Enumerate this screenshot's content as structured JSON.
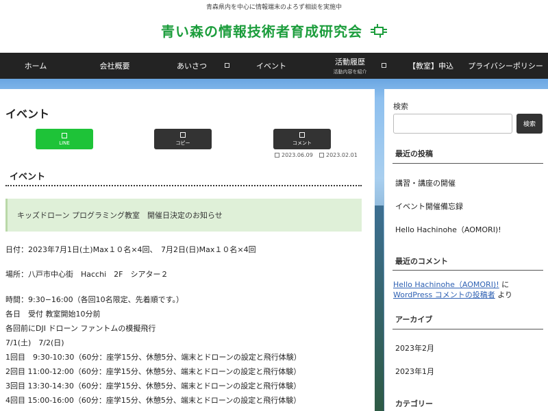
{
  "header": {
    "tagline": "青森県内を中心に情報端末のよろず相談を実施中",
    "site_title": "青い森の情報技術者育成研究会"
  },
  "nav": {
    "items": [
      {
        "label": "ホーム"
      },
      {
        "label": "会社概要"
      },
      {
        "label": "あいさつ"
      },
      {
        "label": "イベント"
      },
      {
        "label": "活動履歴",
        "sub": "活動内容を紹介"
      },
      {
        "label": "【教室】申込"
      },
      {
        "label": "プライバシーポリシー"
      }
    ]
  },
  "main": {
    "page_title": "イベント",
    "share": {
      "line": "LINE",
      "copy": "コピー",
      "comment": "コメント"
    },
    "date_updated": "2023.06.09",
    "date_published": "2023.02.01",
    "section_title": "イベント",
    "notice": "キッズドローン プログラミング教室　開催日決定のお知らせ",
    "lines": [
      "日付：2023年7月1日(土)Max１０名×4回、　7月2日(日)Max１０名×4回",
      "場所：八戸市中心街　Hacchi　2F　シアター２",
      "時間：9:30−16:00（各回10名限定、先着順です。）",
      "各日　受付 教室開始10分前",
      "各回前にDJI ドローン ファントムの模擬飛行",
      "7/1(土)　7/2(日)",
      "1回目　9:30-10:30（60分：座学15分、休憩5分、端末とドローンの設定と飛行体験）",
      "2回目 11:00-12:00（60分：座学15分、休憩5分、端末とドローンの設定と飛行体験）",
      "3回目 13:30-14:30（60分：座学15分、休憩5分、端末とドローンの設定と飛行体験）",
      "4回目 15:00-16:00（60分：座学15分、休憩5分、端末とドローンの設定と飛行体験）"
    ]
  },
  "sidebar": {
    "search_label": "検索",
    "search_button": "検索",
    "recent_posts_title": "最近の投稿",
    "recent_posts": [
      "講習・講座の開催",
      "イベント開催備忘録",
      "Hello Hachinohe（AOMORI)!"
    ],
    "recent_comments_title": "最近のコメント",
    "comment": {
      "post_link": "Hello Hachinohe（AOMORI)!",
      "on": " に ",
      "author_link": "WordPress コメントの投稿者",
      "by": " より"
    },
    "archives_title": "アーカイブ",
    "archives": [
      "2023年2月",
      "2023年1月"
    ],
    "categories_title": "カテゴリー"
  },
  "colors": {
    "brand_green": "#1c9d3c",
    "nav_bg": "#232323",
    "line_green": "#1ec338",
    "notice_bg": "#dff0d8",
    "link_blue": "#2d60b3"
  }
}
